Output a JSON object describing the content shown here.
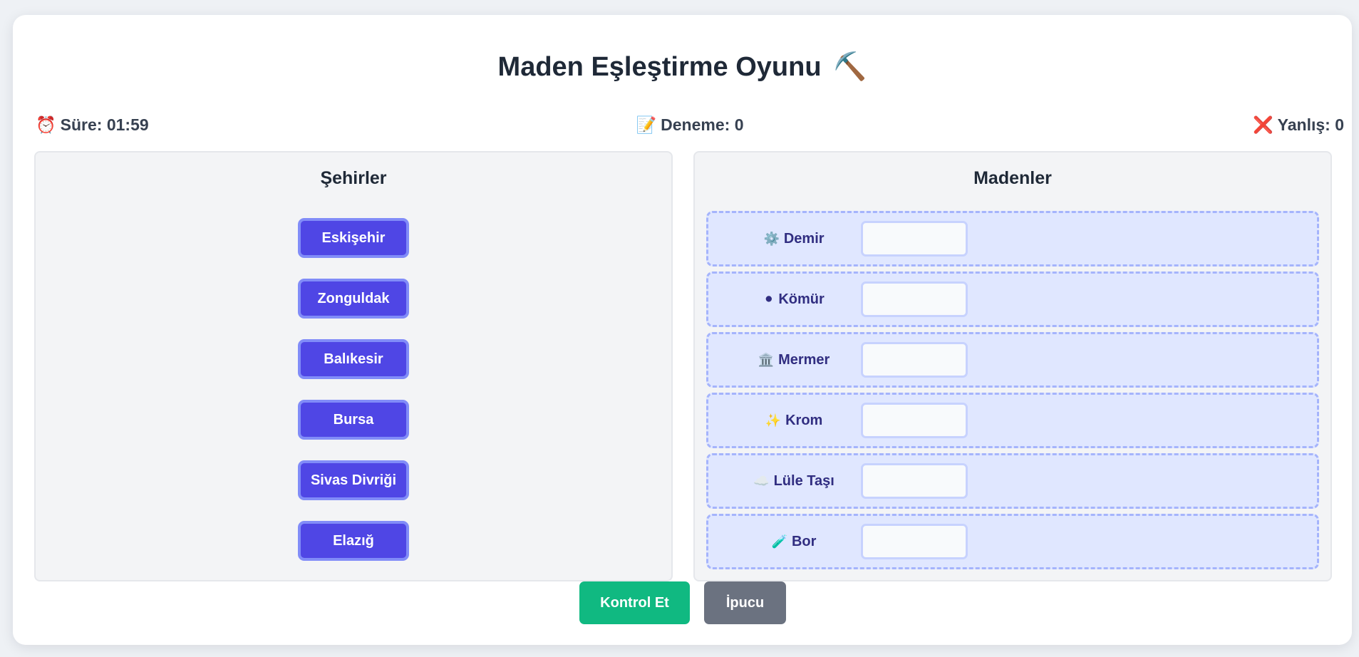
{
  "game": {
    "title": "Maden Eşleştirme Oyunu",
    "title_icon": "⛏️"
  },
  "stats": {
    "time_icon": "⏰",
    "time_label": "Süre: 01:59",
    "attempt_icon": "📝",
    "attempt_label": "Deneme: 0",
    "wrong_icon": "❌",
    "wrong_label": "Yanlış: 0"
  },
  "cities_panel": {
    "title": "Şehirler",
    "items": [
      {
        "label": "Eskişehir"
      },
      {
        "label": "Zonguldak"
      },
      {
        "label": "Balıkesir"
      },
      {
        "label": "Bursa"
      },
      {
        "label": "Sivas Divriği"
      },
      {
        "label": "Elazığ"
      }
    ]
  },
  "mines_panel": {
    "title": "Madenler",
    "items": [
      {
        "icon": "⚙️",
        "label": "Demir",
        "match": ""
      },
      {
        "icon": "⚫",
        "label": "Kömür",
        "match": ""
      },
      {
        "icon": "🏛️",
        "label": "Mermer",
        "match": ""
      },
      {
        "icon": "✨",
        "label": "Krom",
        "match": ""
      },
      {
        "icon": "☁️",
        "label": "Lüle Taşı",
        "match": ""
      },
      {
        "icon": "🧪",
        "label": "Bor",
        "match": ""
      }
    ]
  },
  "actions": {
    "check_label": "Kontrol Et",
    "hint_label": "İpucu"
  },
  "colors": {
    "city_button": "#4f46e5",
    "mine_row": "#e0e7ff",
    "check_button": "#10b981",
    "hint_button": "#6b7280"
  }
}
